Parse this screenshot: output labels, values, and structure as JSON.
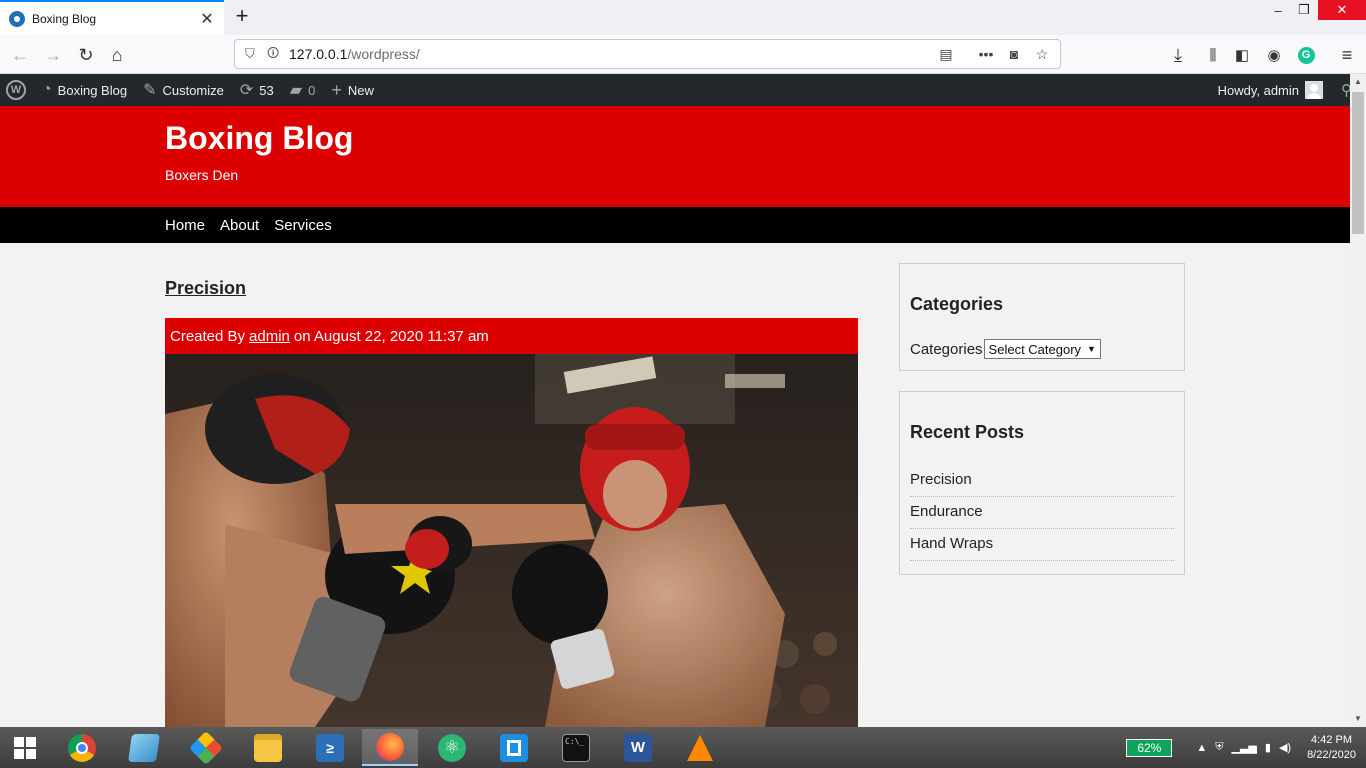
{
  "browser": {
    "tab_title": "Boxing Blog",
    "url_host": "127.0.0.1",
    "url_path": "/wordpress/"
  },
  "adminbar": {
    "site_name": "Boxing Blog",
    "customize": "Customize",
    "updates_count": "53",
    "comments_count": "0",
    "new_label": "New",
    "howdy": "Howdy, admin"
  },
  "site": {
    "title": "Boxing Blog",
    "tagline": "Boxers Den",
    "nav": [
      "Home",
      "About",
      "Services"
    ]
  },
  "post": {
    "title": "Precision",
    "meta_prefix": "Created By",
    "author": "admin",
    "meta_suffix": "on August 22, 2020 11:37 am"
  },
  "sidebar": {
    "categories_heading": "Categories",
    "categories_label": "Categories",
    "categories_select": "Select Category",
    "recent_heading": "Recent Posts",
    "recent_posts": [
      "Precision",
      "Endurance",
      "Hand Wraps"
    ]
  },
  "taskbar": {
    "battery": "62%",
    "time": "4:42 PM",
    "date": "8/22/2020"
  }
}
